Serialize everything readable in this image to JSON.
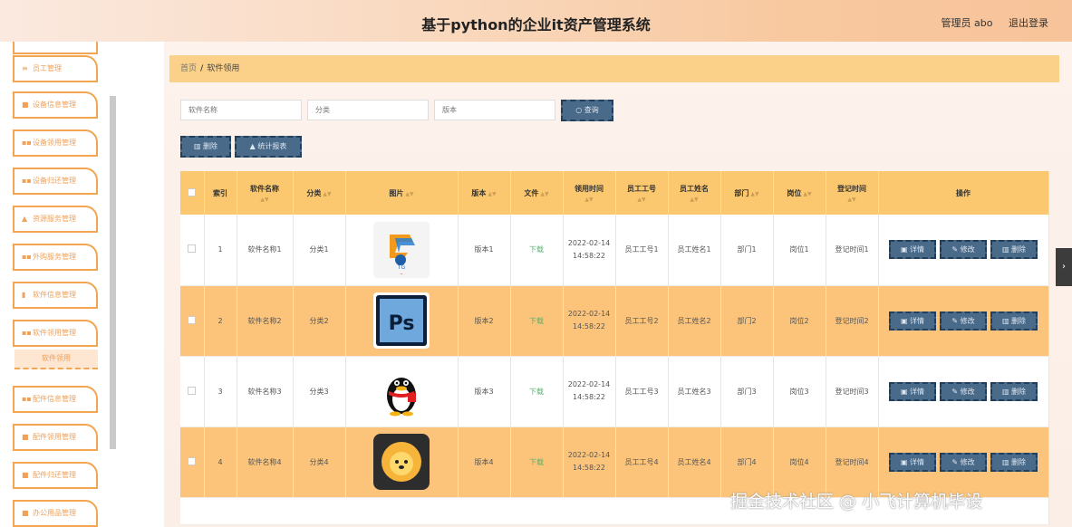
{
  "header": {
    "title": "基于python的企业it资产管理系统",
    "user": "管理员 abo",
    "logout": "退出登录"
  },
  "sidebar": {
    "items": [
      {
        "label": "员工管理",
        "icon": "≡"
      },
      {
        "label": "设备信息管理",
        "icon": "■"
      },
      {
        "label": "设备领用管理",
        "icon": "▪▪"
      },
      {
        "label": "设备归还管理",
        "icon": "▪▪"
      },
      {
        "label": "资源服务管理",
        "icon": "▲"
      },
      {
        "label": "外购服务管理",
        "icon": "▪▪"
      },
      {
        "label": "软件信息管理",
        "icon": "▮"
      },
      {
        "label": "软件领用管理",
        "icon": "▪▪"
      },
      {
        "label": "配件信息管理",
        "icon": "▪▪"
      },
      {
        "label": "配件领用管理",
        "icon": "■"
      },
      {
        "label": "配件归还管理",
        "icon": "■"
      },
      {
        "label": "办公用品管理",
        "icon": "■"
      }
    ],
    "active_sub": "软件领用"
  },
  "breadcrumb": {
    "home": "首页",
    "sep": "/",
    "current": "软件领用"
  },
  "search": {
    "name_placeholder": "软件名称",
    "category_placeholder": "分类",
    "version_placeholder": "版本",
    "query_label": "查询"
  },
  "actions": {
    "delete_label": "删除",
    "stats_label": "统计报表"
  },
  "table": {
    "headers": [
      "索引",
      "软件名称",
      "分类",
      "图片",
      "版本",
      "文件",
      "领用时间",
      "员工工号",
      "员工姓名",
      "部门",
      "岗位",
      "登记时间",
      "操作"
    ],
    "rows": [
      {
        "index": "1",
        "name": "软件名称1",
        "category": "分类1",
        "version": "版本1",
        "file": "下载",
        "time": "2022-02-14 14:58:22",
        "emp_no": "员工工号1",
        "emp_name": "员工姓名1",
        "dept": "部门1",
        "post": "岗位1",
        "reg": "登记时间1",
        "icon": "tencent-games-icon"
      },
      {
        "index": "2",
        "name": "软件名称2",
        "category": "分类2",
        "version": "版本2",
        "file": "下载",
        "time": "2022-02-14 14:58:22",
        "emp_no": "员工工号2",
        "emp_name": "员工姓名2",
        "dept": "部门2",
        "post": "岗位2",
        "reg": "登记时间2",
        "icon": "photoshop-icon"
      },
      {
        "index": "3",
        "name": "软件名称3",
        "category": "分类3",
        "version": "版本3",
        "file": "下载",
        "time": "2022-02-14 14:58:22",
        "emp_no": "员工工号3",
        "emp_name": "员工姓名3",
        "dept": "部门3",
        "post": "岗位3",
        "reg": "登记时间3",
        "icon": "qq-penguin-icon"
      },
      {
        "index": "4",
        "name": "软件名称4",
        "category": "分类4",
        "version": "版本4",
        "file": "下载",
        "time": "2022-02-14 14:58:22",
        "emp_no": "员工工号4",
        "emp_name": "员工姓名4",
        "dept": "部门4",
        "post": "岗位4",
        "reg": "登记时间4",
        "icon": "lion-app-icon"
      }
    ],
    "op_detail": "详情",
    "op_edit": "修改",
    "op_delete": "删除"
  },
  "watermark": "掘金技术社区 @ 小飞计算机毕设",
  "colors": {
    "accent": "#fbc86f",
    "button": "#4a6a8a",
    "sidebar_border": "#f3a552"
  }
}
